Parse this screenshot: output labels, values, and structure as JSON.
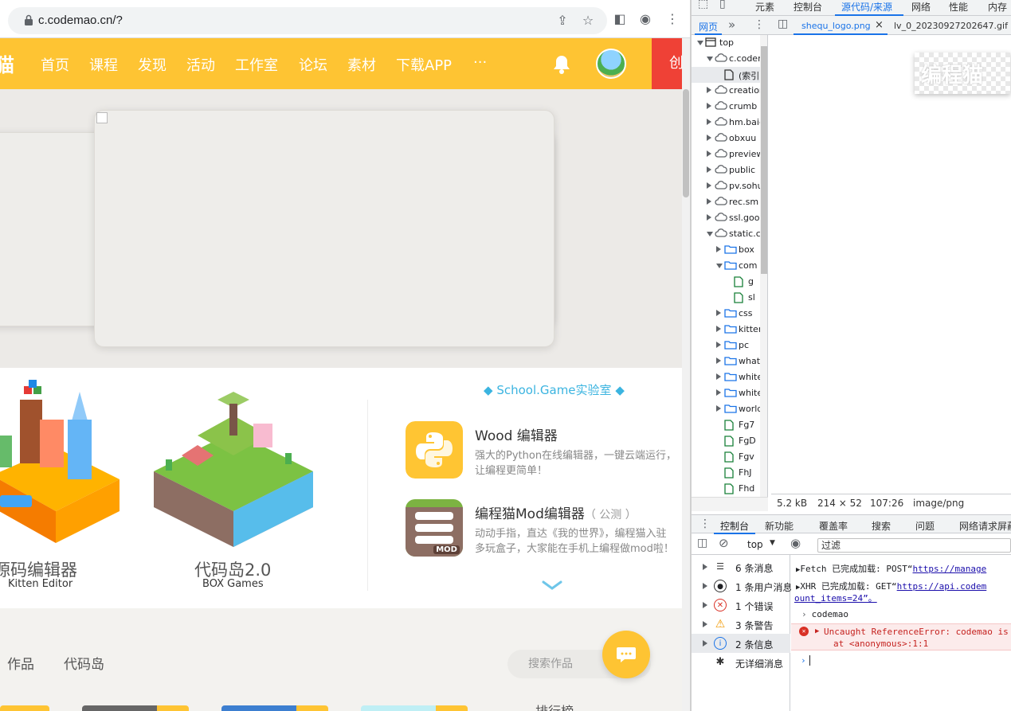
{
  "browser": {
    "url": "c.codemao.cn/?",
    "icons": [
      "lock-icon",
      "share-icon",
      "star-icon",
      "sidebar-icon",
      "profile-icon",
      "kebab-icon"
    ]
  },
  "nav": {
    "logo_fragment": "猫",
    "items": [
      "首页",
      "课程",
      "发现",
      "活动",
      "工作室",
      "论坛",
      "素材",
      "下载APP",
      "···"
    ],
    "create_label": "创"
  },
  "editors": [
    {
      "title": "源码编辑器",
      "subtitle": "Kitten Editor"
    },
    {
      "title": "代码岛2.0",
      "subtitle": "BOX Games"
    }
  ],
  "lab": {
    "title": "School.Game实验室",
    "tools": [
      {
        "title": "Wood 编辑器",
        "badge": "",
        "desc1": "强大的Python在线编辑器，一键云端运行，",
        "desc2": "让编程更简单！"
      },
      {
        "title": "编程猫Mod编辑器",
        "badge": "（ 公测 ）",
        "desc1": "动动手指，直达《我的世界》，编程猫入驻",
        "desc2": "多玩盒子，大家能在手机上编程做mod啦！"
      }
    ],
    "mod_label": "MOD"
  },
  "works": {
    "tabs": [
      "作品",
      "代码岛"
    ],
    "search_placeholder": "搜索作品",
    "rank_label": "排行榜"
  },
  "devtools": {
    "top_tabs": [
      "元素",
      "控制台",
      "源代码/来源",
      "网络",
      "性能",
      "内存"
    ],
    "active_top_tab": "源代码/来源",
    "nav_tab": "网页",
    "more_tabs": "»",
    "file_tabs": [
      {
        "name": "shequ_logo.png",
        "close": "×"
      },
      {
        "name": "lv_0_20230927202647.gif"
      }
    ],
    "tree": [
      {
        "depth": 0,
        "arrow": "d",
        "icon": "frame",
        "label": "top"
      },
      {
        "depth": 1,
        "arrow": "d",
        "icon": "cloud",
        "label": "c.codemao.cn"
      },
      {
        "depth": 2,
        "arrow": "",
        "icon": "file",
        "label": "(索引)"
      },
      {
        "depth": 1,
        "arrow": "r",
        "icon": "cloud",
        "label": "creation"
      },
      {
        "depth": 1,
        "arrow": "r",
        "icon": "cloud",
        "label": "crumb"
      },
      {
        "depth": 1,
        "arrow": "r",
        "icon": "cloud",
        "label": "hm.baidu"
      },
      {
        "depth": 1,
        "arrow": "r",
        "icon": "cloud",
        "label": "obxuu"
      },
      {
        "depth": 1,
        "arrow": "r",
        "icon": "cloud",
        "label": "preview"
      },
      {
        "depth": 1,
        "arrow": "r",
        "icon": "cloud",
        "label": "public"
      },
      {
        "depth": 1,
        "arrow": "r",
        "icon": "cloud",
        "label": "pv.sohu"
      },
      {
        "depth": 1,
        "arrow": "r",
        "icon": "cloud",
        "label": "rec.sm"
      },
      {
        "depth": 1,
        "arrow": "r",
        "icon": "cloud",
        "label": "ssl.goo"
      },
      {
        "depth": 1,
        "arrow": "d",
        "icon": "cloud",
        "label": "static.c"
      },
      {
        "depth": 2,
        "arrow": "r",
        "icon": "folder",
        "label": "box"
      },
      {
        "depth": 2,
        "arrow": "d",
        "icon": "folder",
        "label": "com"
      },
      {
        "depth": 3,
        "arrow": "",
        "icon": "gfile",
        "label": "g"
      },
      {
        "depth": 3,
        "arrow": "",
        "icon": "gfile",
        "label": "sl"
      },
      {
        "depth": 2,
        "arrow": "r",
        "icon": "folder",
        "label": "css"
      },
      {
        "depth": 2,
        "arrow": "r",
        "icon": "folder",
        "label": "kitten"
      },
      {
        "depth": 2,
        "arrow": "r",
        "icon": "folder",
        "label": "pc"
      },
      {
        "depth": 2,
        "arrow": "r",
        "icon": "folder",
        "label": "what"
      },
      {
        "depth": 2,
        "arrow": "r",
        "icon": "folder",
        "label": "white"
      },
      {
        "depth": 2,
        "arrow": "r",
        "icon": "folder",
        "label": "white"
      },
      {
        "depth": 2,
        "arrow": "r",
        "icon": "folder",
        "label": "world"
      },
      {
        "depth": 2,
        "arrow": "",
        "icon": "gfile",
        "label": "Fg7"
      },
      {
        "depth": 2,
        "arrow": "",
        "icon": "gfile",
        "label": "FgD"
      },
      {
        "depth": 2,
        "arrow": "",
        "icon": "gfile",
        "label": "Fgv"
      },
      {
        "depth": 2,
        "arrow": "",
        "icon": "gfile",
        "label": "FhJ"
      },
      {
        "depth": 2,
        "arrow": "",
        "icon": "gfile",
        "label": "Fhd"
      }
    ],
    "preview_text": "编程猫",
    "image_info": {
      "size": "5.2 kB",
      "dims": "214 × 52",
      "cursor": "107:26",
      "mime": "image/png"
    },
    "drawer_tabs": [
      "控制台",
      "新功能",
      "覆盖率",
      "搜索",
      "问题",
      "网络请求屏蔽"
    ],
    "context": "top",
    "filter_placeholder": "过滤",
    "sidebar": [
      {
        "label": "6 条消息",
        "icon": "list-icon"
      },
      {
        "label": "1 条用户消息",
        "icon": "user-icon"
      },
      {
        "label": "1 个错误",
        "icon": "error-icon"
      },
      {
        "label": "3 条警告",
        "icon": "warning-icon"
      },
      {
        "label": "2 条信息",
        "icon": "info-icon"
      },
      {
        "label": "无详细消息",
        "icon": "bug-icon"
      }
    ],
    "log": {
      "fetch_prefix": "Fetch 已完成加载: POST“",
      "fetch_url": "https://manage",
      "xhr_prefix": "XHR 已完成加载: GET“",
      "xhr_url": "https://api.codem",
      "xhr_tail": "ount_items=24”。",
      "input": "codemao",
      "error_msg": "Uncaught ReferenceError: codemao is",
      "error_loc": "at <anonymous>:1:1"
    },
    "colors": {
      "accent": "#1a73e8",
      "error": "#d93025",
      "warning": "#f29900",
      "info": "#1a73e8"
    }
  },
  "colors": {
    "nav": "#fec433",
    "create": "#ef4136",
    "lab": "#3bb4e0"
  }
}
